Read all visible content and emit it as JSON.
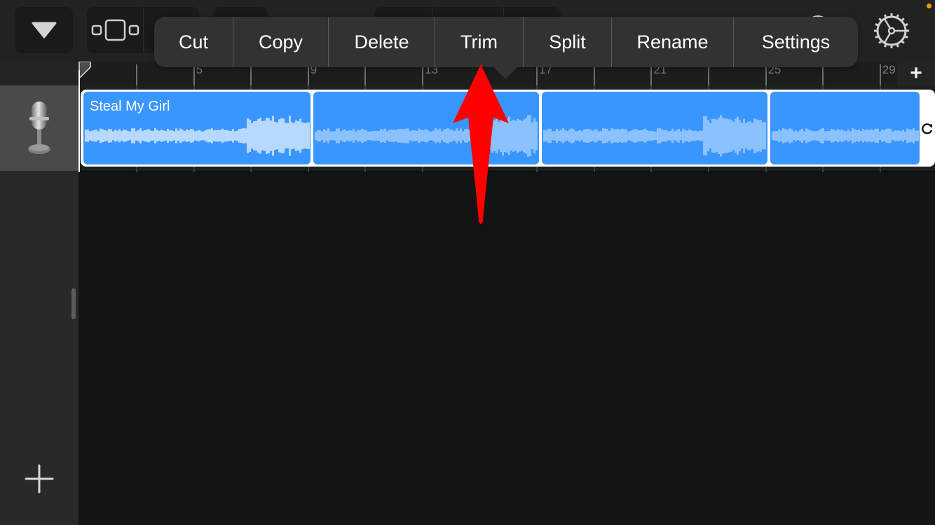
{
  "toolbar": {
    "tracks_button_icon": "triangle-down-icon",
    "view_button_icon": "track-view-icon",
    "settings_icon": "gear-icon",
    "record_color": "#e8403a",
    "notification_dot_color": "#f0961e"
  },
  "ruler": {
    "labels": [
      "5",
      "9",
      "13",
      "17",
      "21",
      "25",
      "29"
    ],
    "add_section_label": "+"
  },
  "context_menu": {
    "items": [
      {
        "label": "Cut"
      },
      {
        "label": "Copy"
      },
      {
        "label": "Delete"
      },
      {
        "label": "Trim"
      },
      {
        "label": "Split"
      },
      {
        "label": "Rename"
      },
      {
        "label": "Settings"
      }
    ]
  },
  "track": {
    "instrument_icon": "microphone-icon",
    "region_name": "Steal My Girl",
    "region_color": "#3a96ff",
    "loop_segments": 4
  },
  "sidebar": {
    "add_track_label": "+"
  },
  "annotation": {
    "arrow_color": "#ff0000",
    "points_to": "Trim"
  }
}
